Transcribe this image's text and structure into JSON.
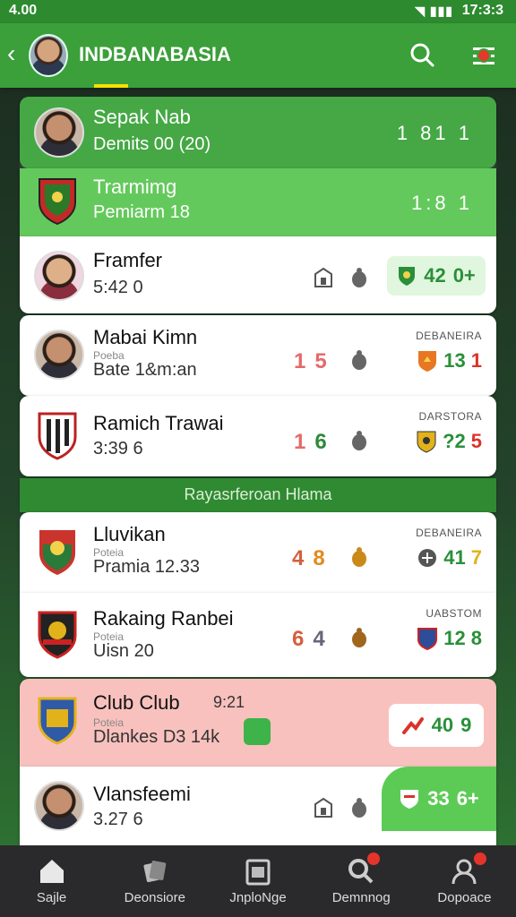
{
  "status_bar": {
    "time_left": "4.00",
    "time_right": "17:3:3"
  },
  "app_bar": {
    "title": "INDBANABASIA"
  },
  "cards": [
    {
      "name": "Sepak Nab",
      "sub": "Demits 00 (20)",
      "score": "1 81 1"
    },
    {
      "name": "Trarmimg",
      "sub": "Pemiarm 18",
      "score": "1:8 1"
    },
    {
      "name": "Framfer",
      "sub": "5:42 0",
      "result": [
        "42",
        "0+"
      ]
    },
    {
      "name": "Mabai Kimn",
      "small": "Poeba",
      "sub": "Bate 1&m:an",
      "mid": [
        "1",
        "5"
      ],
      "league": "DEBANEIRA",
      "result": [
        "13",
        "1"
      ]
    },
    {
      "name": "Ramich Trawai",
      "sub": "3:39 6",
      "mid": [
        "1",
        "6"
      ],
      "league": "DARSTORA",
      "result": [
        "?2",
        "5"
      ]
    },
    {
      "name": "Lluvikan",
      "small": "Poteia",
      "sub": "Pramia 12.33",
      "mid": [
        "4",
        "8"
      ],
      "league": "DEBANEIRA",
      "result": [
        "41",
        "7"
      ]
    },
    {
      "name": "Rakaing Ranbei",
      "small": "Poteia",
      "sub": "Uisn 20",
      "mid": [
        "6",
        "4"
      ],
      "league": "UABSTOM",
      "result": [
        "12",
        "8"
      ]
    },
    {
      "name": "Club Club",
      "extra": "9:21",
      "small": "Poteia",
      "sub": "Dlankes D3 14k",
      "result": [
        "40",
        "9"
      ]
    },
    {
      "name": "Vlansfeemi",
      "sub": "3.27 6",
      "result": [
        "33",
        "6+"
      ]
    }
  ],
  "divider": "Rayasrferoan Hlama",
  "nav": [
    {
      "label": "Sajle"
    },
    {
      "label": "Deonsiore"
    },
    {
      "label": "JnploNge"
    },
    {
      "label": "Demnnog"
    },
    {
      "label": "Dopoace"
    }
  ],
  "colors": {
    "accent": "#3b9f3a",
    "highlight": "#f5e000",
    "pink": "#f9c1be"
  }
}
